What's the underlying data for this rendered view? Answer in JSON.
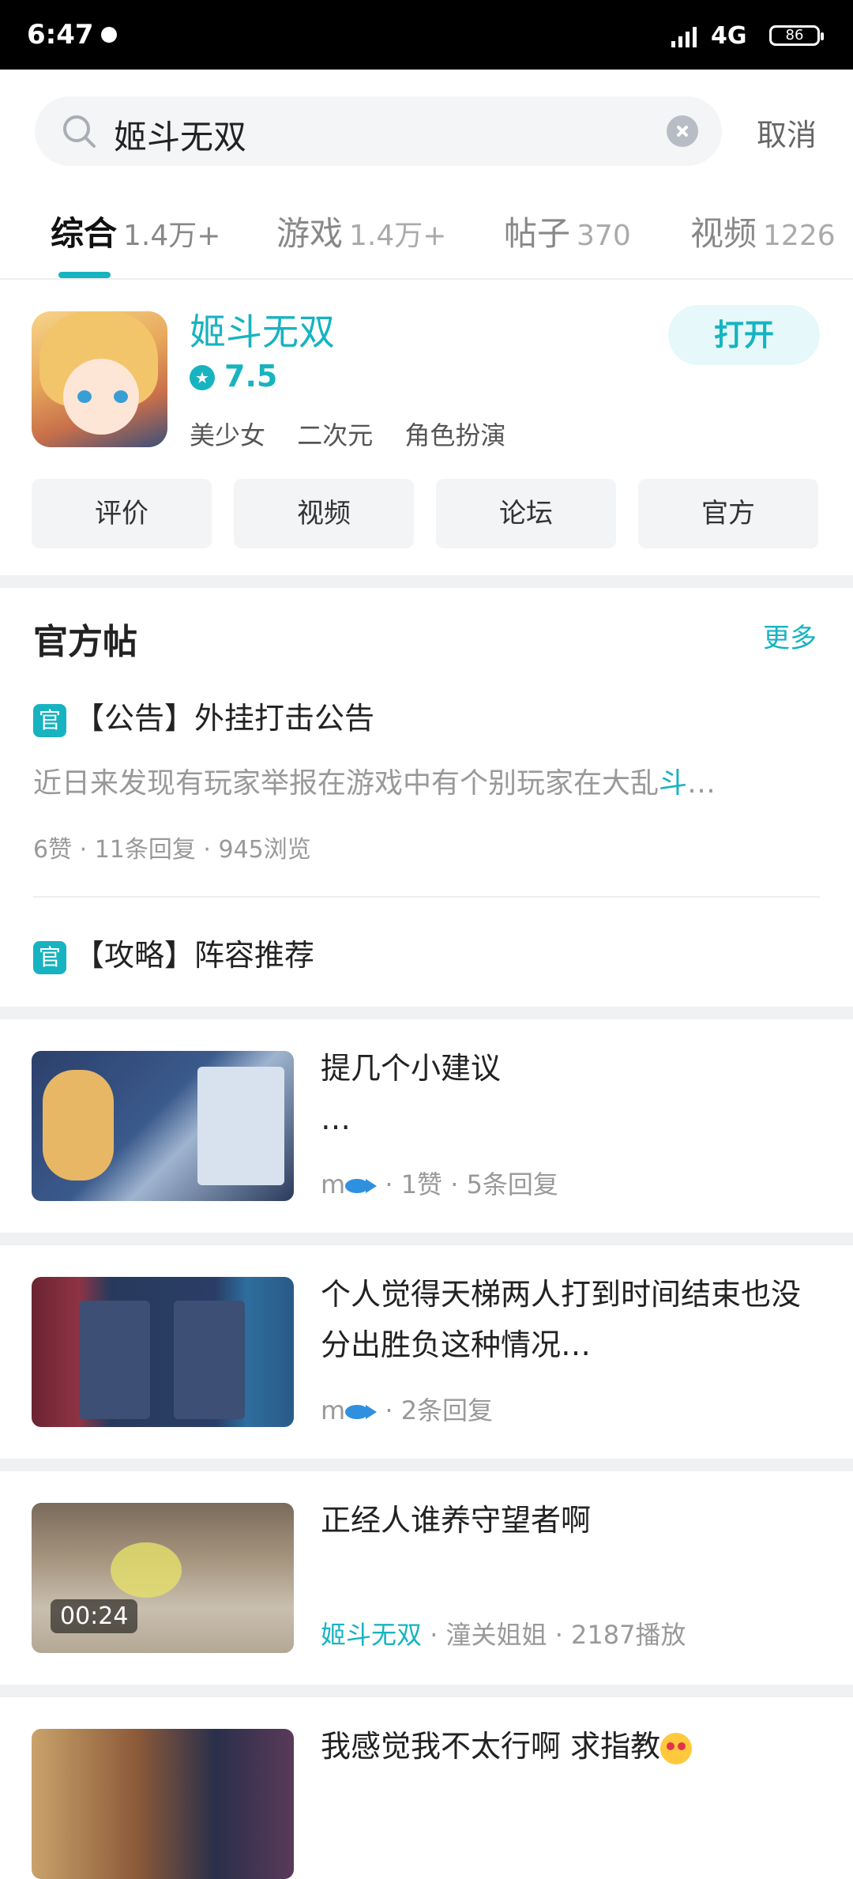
{
  "status": {
    "time": "6:47",
    "network": "4G",
    "battery": "86"
  },
  "search": {
    "query": "姬斗无双",
    "cancel": "取消"
  },
  "tabs": [
    {
      "label": "综合",
      "count": "1.4万+"
    },
    {
      "label": "游戏",
      "count": "1.4万+"
    },
    {
      "label": "帖子",
      "count": "370"
    },
    {
      "label": "视频",
      "count": "1226"
    }
  ],
  "game": {
    "name": "姬斗无双",
    "rating": "7.5",
    "tags": [
      "美少女",
      "二次元",
      "角色扮演"
    ],
    "open_label": "打开",
    "buttons": [
      "评价",
      "视频",
      "论坛",
      "官方"
    ]
  },
  "official": {
    "title": "官方帖",
    "more": "更多",
    "badge": "官",
    "posts": [
      {
        "title": "【公告】外挂打击公告",
        "excerpt_plain": "近日来发现有玩家举报在游戏中有个别玩家在大乱",
        "excerpt_hl": "斗",
        "excerpt_ellipsis": "…",
        "meta": "6赞 · 11条回复 · 945浏览"
      },
      {
        "title": "【攻略】阵容推荐"
      }
    ]
  },
  "feed": [
    {
      "title": "提几个小建议",
      "title2": "…",
      "author": "m",
      "meta": " · 1赞 · 5条回复"
    },
    {
      "title": "个人觉得天梯两人打到时间结束也没分出胜负这种情况…",
      "author": "m",
      "meta": " · 2条回复"
    },
    {
      "title": "正经人谁养守望者啊",
      "duration": "00:24",
      "game_link": "姬斗无双",
      "meta": " · 潼关姐姐 · 2187播放"
    },
    {
      "title": "我感觉我不太行啊  求指教"
    }
  ],
  "colors": {
    "accent": "#17b3c0",
    "separator": "#f0f1f3"
  }
}
